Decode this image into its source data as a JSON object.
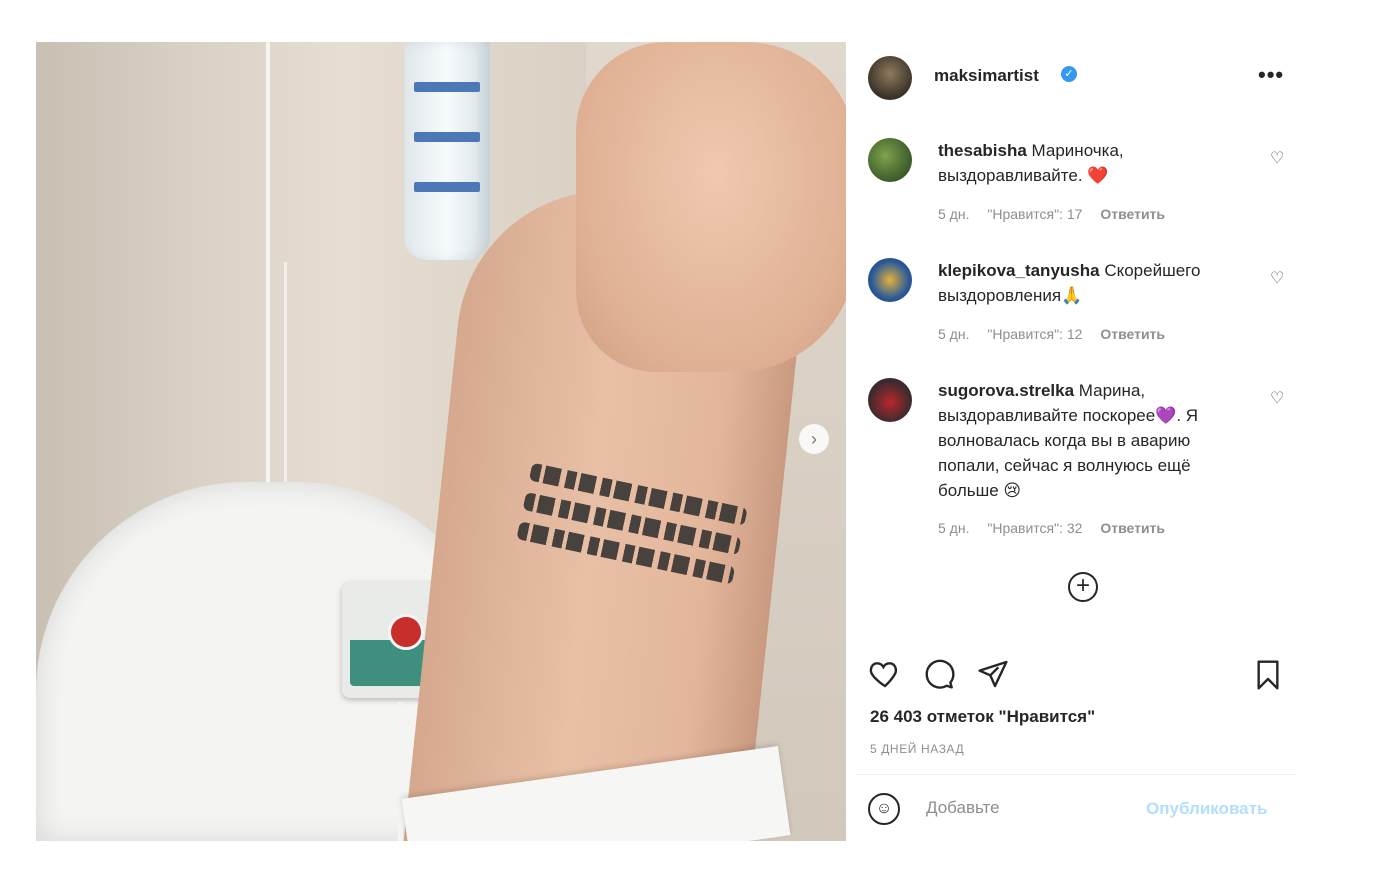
{
  "post": {
    "author": "maksimartist",
    "verified_mark": "✓",
    "more_glyph": "•••",
    "next_arrow": "›",
    "image_alt": "Рука с татуировкой и капельницей в больничной палате"
  },
  "comments": [
    {
      "username": "thesabisha",
      "text": "Мариночка, выздоравливайте. ❤️",
      "time": "5 дн.",
      "likes": "\"Нравится\": 17",
      "reply": "Ответить"
    },
    {
      "username": "klepikova_tanyusha",
      "text": "Скорейшего выздоровления🙏",
      "time": "5 дн.",
      "likes": "\"Нравится\": 12",
      "reply": "Ответить"
    },
    {
      "username": "sugorova.strelka",
      "text": "Марина, выздоравливайте поскорее💜. Я волновалась когда вы в аварию попали, сейчас я волнуюсь ещё больше 😢",
      "time": "5 дн.",
      "likes": "\"Нравится\": 32",
      "reply": "Ответить"
    }
  ],
  "load_more_glyph": "+",
  "icons": {
    "heart": "♡",
    "comment": "◯",
    "share": "▷",
    "bookmark": "⎕",
    "emoji": "☺"
  },
  "likes_text": "26 403 отметок \"Нравится\"",
  "posted_ago": "5 ДНЕЙ НАЗАД",
  "add_comment": {
    "placeholder": "Добавьте",
    "publish_label": "Опубликовать"
  }
}
